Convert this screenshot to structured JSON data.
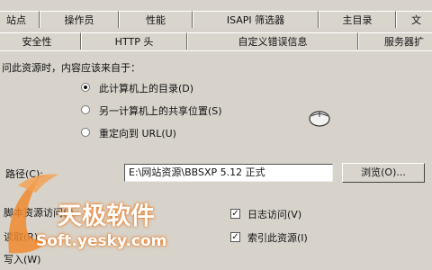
{
  "tabs_row1": [
    {
      "label": "站点"
    },
    {
      "label": "操作员"
    },
    {
      "label": "性能"
    },
    {
      "label": "ISAPI 筛选器"
    },
    {
      "label": "主目录"
    },
    {
      "label": "文"
    }
  ],
  "tabs_row2": [
    {
      "label": "安全性"
    },
    {
      "label": "HTTP 头"
    },
    {
      "label": "自定义错误信息"
    },
    {
      "label": "服务器扩"
    }
  ],
  "section": {
    "question": "问此资源时，内容应该来自于："
  },
  "options": [
    {
      "label": "此计算机上的目录(D)",
      "selected": true
    },
    {
      "label": "另一计算机上的共享位置(S)",
      "selected": false
    },
    {
      "label": "重定向到 URL(U)",
      "selected": false
    }
  ],
  "path": {
    "label": "路径(C):",
    "value": "E:\\网站资源\\BBSXP 5.12 正式",
    "browse_label": "浏览(O)..."
  },
  "permissions_left": [
    {
      "label": "脚本资源访问(I)"
    },
    {
      "label": "读取(R)"
    },
    {
      "label": "写入(W)"
    }
  ],
  "permissions_right": [
    {
      "label": "日志访问(V)",
      "checked": true
    },
    {
      "label": "索引此资源(I)",
      "checked": true
    }
  ],
  "watermark": {
    "brand": "天极软件",
    "url": "Soft.yesky.com"
  },
  "icons": {
    "radio": "radio-icon",
    "checkbox": "checkbox-icon",
    "cursor": "mouse-cursor-icon",
    "logo": "yesky-logo-icon"
  }
}
